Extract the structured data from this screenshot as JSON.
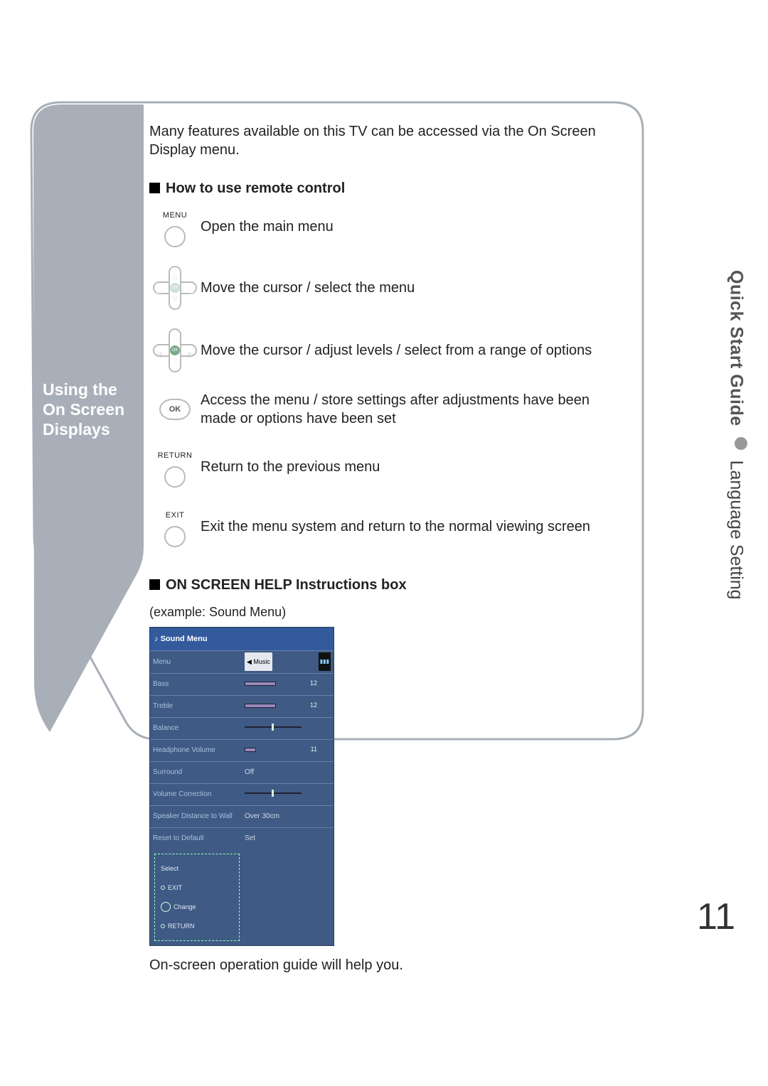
{
  "page_number": "11",
  "side_tab": {
    "section": "Quick Start Guide",
    "topic": "Language Setting"
  },
  "sidebar_title": "Using the On Screen Displays",
  "intro": "Many features available on this TV can be accessed via the On Screen Display menu.",
  "section1": {
    "heading": "How to use remote control",
    "rows": {
      "menu": {
        "label": "MENU",
        "desc": "Open the main menu"
      },
      "updown": {
        "desc": "Move the cursor / select the menu"
      },
      "leftright": {
        "desc": "Move the cursor / adjust levels / select from a range of options"
      },
      "ok": {
        "label": "OK",
        "desc": "Access the menu / store settings after adjustments have been made or options have been set"
      },
      "return": {
        "label": "RETURN",
        "desc": "Return to the previous menu"
      },
      "exit": {
        "label": "EXIT",
        "desc": "Exit the menu system and return to the normal viewing screen"
      }
    }
  },
  "section2": {
    "heading": "ON SCREEN HELP Instructions box",
    "example_label": "(example: Sound Menu)",
    "osd_title": "Sound Menu",
    "osd_rows": [
      {
        "label": "Menu",
        "value_pill": "Music"
      },
      {
        "label": "Bass",
        "bar_pct": 55,
        "num": "12"
      },
      {
        "label": "Treble",
        "bar_pct": 55,
        "num": "12"
      },
      {
        "label": "Balance",
        "tick": true
      },
      {
        "label": "Headphone Volume",
        "bar_pct": 20,
        "num": "11"
      },
      {
        "label": "Surround",
        "value_text": "Off"
      },
      {
        "label": "Volume Correction",
        "tick": true
      },
      {
        "label": "Speaker Distance to Wall",
        "value_text": "Over 30cm"
      },
      {
        "label": "Reset to Default",
        "value_text": "Set"
      }
    ],
    "help_box": {
      "title": "Select",
      "l1": "EXIT",
      "l2": "Change",
      "l3": "RETURN"
    },
    "caption": "On-screen operation guide will help you."
  }
}
